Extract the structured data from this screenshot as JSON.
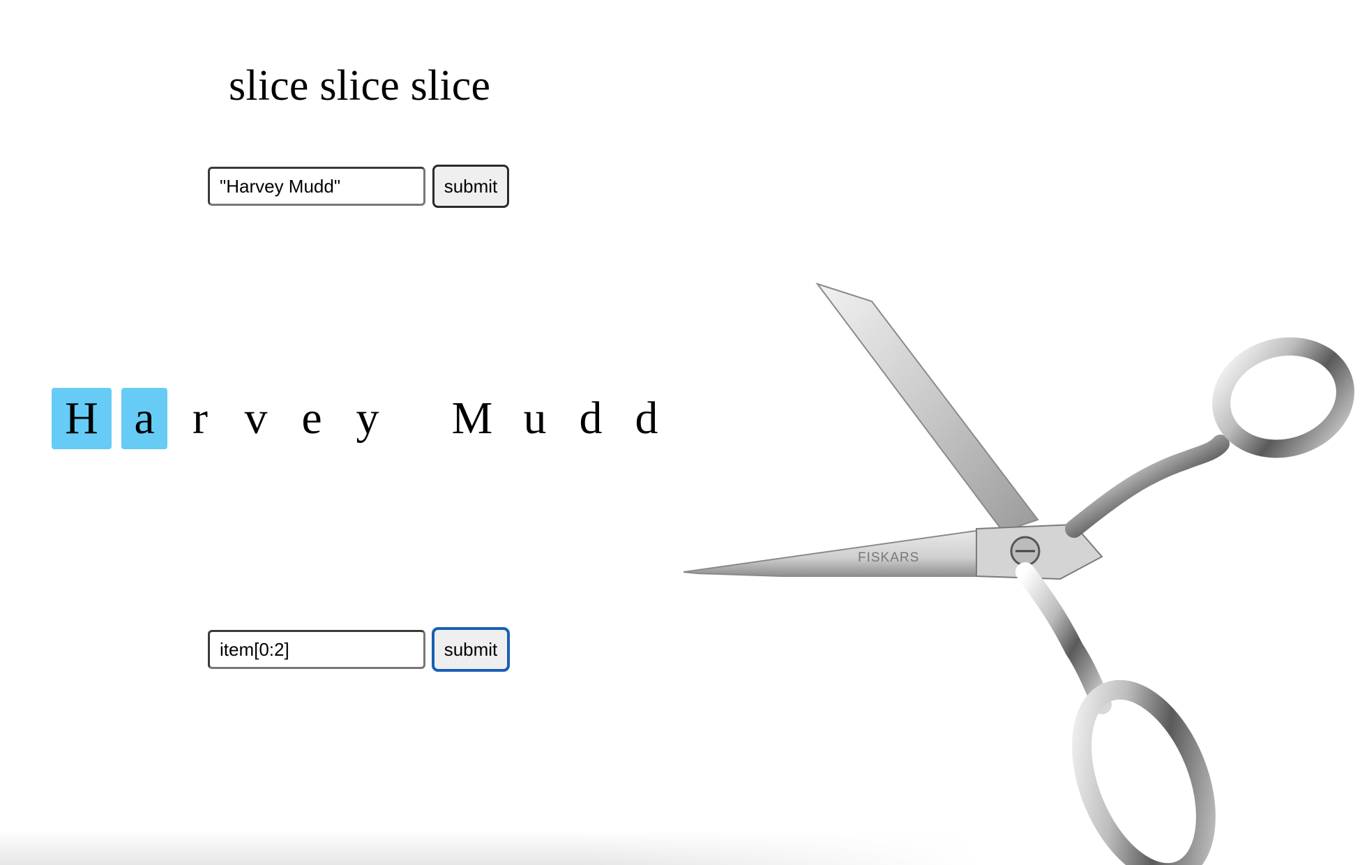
{
  "title": "slice slice slice",
  "string_input": {
    "value": "\"Harvey Mudd\"",
    "submit_label": "submit"
  },
  "slice_input": {
    "value": "item[0:2]",
    "submit_label": "submit"
  },
  "letters": [
    {
      "char": "H",
      "highlighted": true
    },
    {
      "char": "a",
      "highlighted": true
    },
    {
      "char": "r",
      "highlighted": false
    },
    {
      "char": "v",
      "highlighted": false
    },
    {
      "char": "e",
      "highlighted": false
    },
    {
      "char": "y",
      "highlighted": false
    },
    {
      "char": " ",
      "highlighted": false
    },
    {
      "char": "M",
      "highlighted": false
    },
    {
      "char": "u",
      "highlighted": false
    },
    {
      "char": "d",
      "highlighted": false
    },
    {
      "char": "d",
      "highlighted": false
    }
  ],
  "scissors_brand": "FISKARS",
  "colors": {
    "highlight": "#66ccf5",
    "focus_border": "#1a5fb4"
  }
}
